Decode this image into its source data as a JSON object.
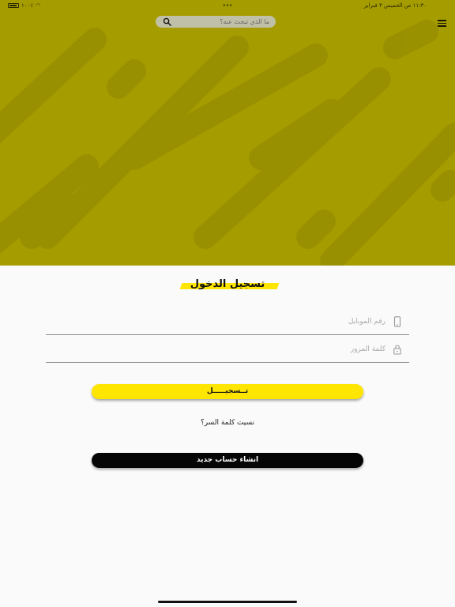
{
  "status_bar": {
    "time_date": "١١:٣٠ ص  الخميس ٣ فبراير",
    "center": "•••",
    "battery": "١٠٠٪"
  },
  "search": {
    "placeholder": "ما الذي تبحث عنه؟"
  },
  "login": {
    "title": "تسجيل الدخول",
    "phone_placeholder": "رقم الموبايل",
    "password_placeholder": "كلمة المرور",
    "login_button": "تــسجيـــــل",
    "forgot_password": "نسيت كلمة السر؟",
    "create_account_button": "انشاء حساب جديد"
  },
  "colors": {
    "hero_background": "#a59c00",
    "accent_yellow": "#ffe600",
    "dark_button": "#050505"
  },
  "icons": {
    "search": "search-icon",
    "menu": "menu-icon",
    "phone": "phone-icon",
    "lock": "lock-icon",
    "wifi": "wifi-icon",
    "battery": "battery-icon"
  }
}
